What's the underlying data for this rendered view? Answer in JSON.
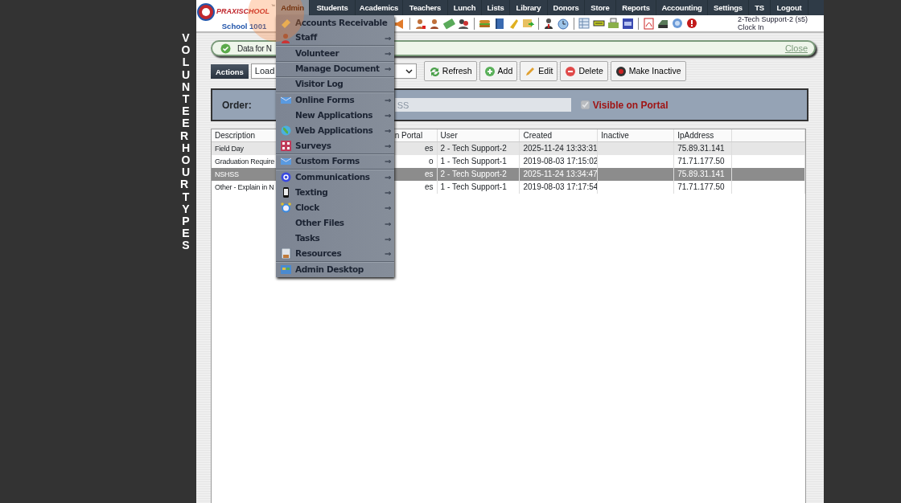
{
  "sidebar_title": "VOLUNTEER HOUR TYPES",
  "logo": {
    "brand": "PRAXISCHOOL",
    "tm": "™",
    "school": "School 1001"
  },
  "nav": [
    {
      "label": "Admin",
      "selected": true
    },
    {
      "label": "Students",
      "selected": false
    },
    {
      "label": "Academics",
      "selected": false
    },
    {
      "label": "Teachers",
      "selected": false
    },
    {
      "label": "Lunch",
      "selected": false
    },
    {
      "label": "Lists",
      "selected": false
    },
    {
      "label": "Library",
      "selected": false
    },
    {
      "label": "Donors",
      "selected": false
    },
    {
      "label": "Store",
      "selected": false
    },
    {
      "label": "Reports",
      "selected": false
    },
    {
      "label": "Accounting",
      "selected": false
    },
    {
      "label": "Settings",
      "selected": false
    },
    {
      "label": "TS",
      "selected": false
    },
    {
      "label": "Logout",
      "selected": false
    }
  ],
  "user": {
    "name": "2-Tech Support-2 (s5)",
    "link": "Clock In"
  },
  "admin_menu": [
    {
      "label": "Accounts Receivable",
      "separated": false
    },
    {
      "label": "Staff",
      "arrow": "⇒",
      "separated": true
    },
    {
      "label": "Volunteer",
      "arrow": "⇒",
      "separated": true
    },
    {
      "label": "Manage Document",
      "arrow": "⇒",
      "separated": true
    },
    {
      "label": "Visitor Log",
      "separated": true
    },
    {
      "label": "Online Forms",
      "arrow": "⇒",
      "separated": false
    },
    {
      "label": "New Applications",
      "arrow": "⇒",
      "separated": false
    },
    {
      "label": "Web Applications",
      "arrow": "⇒",
      "separated": false
    },
    {
      "label": "Surveys",
      "arrow": "⇒",
      "separated": true
    },
    {
      "label": "Custom Forms",
      "arrow": "⇒",
      "separated": true
    },
    {
      "label": "Communications",
      "arrow": "⇒",
      "separated": false
    },
    {
      "label": "Texting",
      "arrow": "⇒",
      "separated": false
    },
    {
      "label": "Clock",
      "arrow": "⇒",
      "separated": false
    },
    {
      "label": "Other Files",
      "arrow": "⇒",
      "separated": false
    },
    {
      "label": "Tasks",
      "arrow": "⇒",
      "separated": false
    },
    {
      "label": "Resources",
      "arrow": "⇒",
      "separated": true
    },
    {
      "label": "Admin Desktop",
      "separated": false
    }
  ],
  "alert": {
    "text": "Data for N",
    "close": "Close"
  },
  "actions": {
    "label": "Actions",
    "select_value": "Load",
    "buttons": [
      "Refresh",
      "Add",
      "Edit",
      "Delete",
      "Make Inactive"
    ]
  },
  "order": {
    "label": "Order:",
    "value": "SS",
    "visible_checked": true,
    "visible_label": "Visible on Portal"
  },
  "table": {
    "columns": [
      "Description",
      "n Portal",
      "User",
      "Created",
      "Inactive",
      "IpAddress"
    ],
    "rows": [
      {
        "cells": [
          "Field Day",
          "es",
          "2 - Tech Support-2",
          "2025-11-24 13:33:31",
          "",
          "75.89.31.141"
        ],
        "selected": false
      },
      {
        "cells": [
          "Graduation Require",
          "o",
          "1 - Tech Support-1",
          "2019-08-03 17:15:02",
          "",
          "71.71.177.50"
        ],
        "selected": false
      },
      {
        "cells": [
          "NSHSS",
          "es",
          "2 - Tech Support-2",
          "2025-11-24 13:34:47",
          "",
          "75.89.31.141"
        ],
        "selected": true
      },
      {
        "cells": [
          "Other - Explain in N",
          "es",
          "1 - Tech Support-1",
          "2019-08-03 17:17:54",
          "",
          "71.71.177.50"
        ],
        "selected": false
      }
    ]
  }
}
